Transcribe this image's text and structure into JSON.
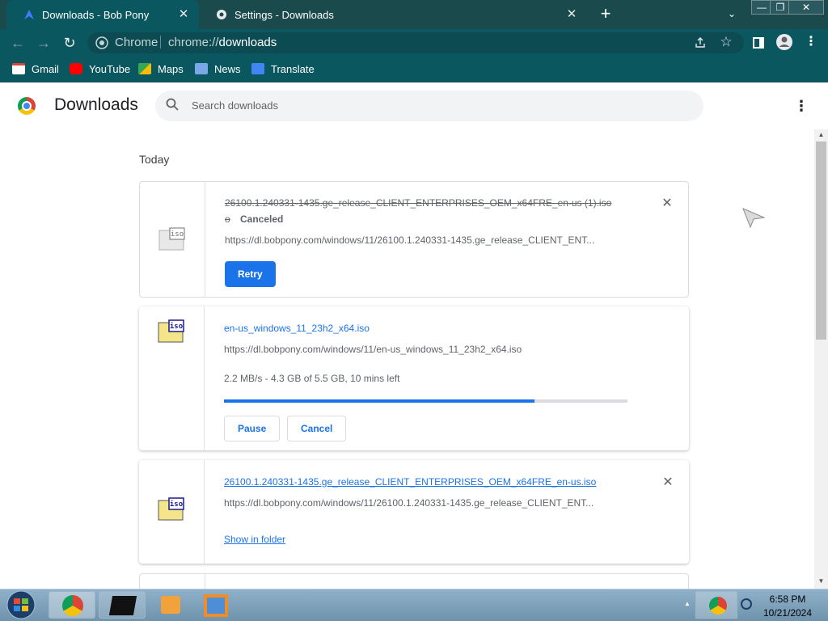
{
  "tabs": [
    {
      "title": "Downloads - Bob Pony",
      "active": true
    },
    {
      "title": "Settings - Downloads",
      "active": false
    }
  ],
  "window_controls": {
    "minimize": "—",
    "restore": "❐",
    "close": "✕"
  },
  "toolbar": {
    "site_label": "Chrome",
    "url_scheme": "chrome://",
    "url_host": "downloads"
  },
  "bookmarks": [
    {
      "label": "Gmail",
      "color": "#db4437"
    },
    {
      "label": "YouTube",
      "color": "#ff0000"
    },
    {
      "label": "Maps",
      "color": "#34a853"
    },
    {
      "label": "News",
      "color": "#4285f4"
    },
    {
      "label": "Translate",
      "color": "#4285f4"
    }
  ],
  "page": {
    "title": "Downloads",
    "search_placeholder": "Search downloads",
    "section": "Today"
  },
  "downloads": [
    {
      "name": "26100.1.240331-1435.ge_release_CLIENT_ENTERPRISES_OEM_x64FRE_en-us (1).iso",
      "name_suffix": "o",
      "status": "Canceled",
      "url": "https://dl.bobpony.com/windows/11/26100.1.240331-1435.ge_release_CLIENT_ENT...",
      "action": "Retry"
    },
    {
      "name": "en-us_windows_11_23h2_x64.iso",
      "url": "https://dl.bobpony.com/windows/11/en-us_windows_11_23h2_x64.iso",
      "progress_text": "2.2 MB/s - 4.3 GB of 5.5 GB, 10 mins left",
      "progress_fraction": 0.77,
      "actions": [
        "Pause",
        "Cancel"
      ]
    },
    {
      "name": "26100.1.240331-1435.ge_release_CLIENT_ENTERPRISES_OEM_x64FRE_en-us.iso",
      "url": "https://dl.bobpony.com/windows/11/26100.1.240331-1435.ge_release_CLIENT_ENT...",
      "action": "Show in folder"
    }
  ],
  "file_icon_label": "iso",
  "taskbar": {
    "time": "6:58 PM",
    "date": "10/21/2024"
  },
  "colors": {
    "accent": "#1a73e8",
    "frame": "#0a5760"
  }
}
